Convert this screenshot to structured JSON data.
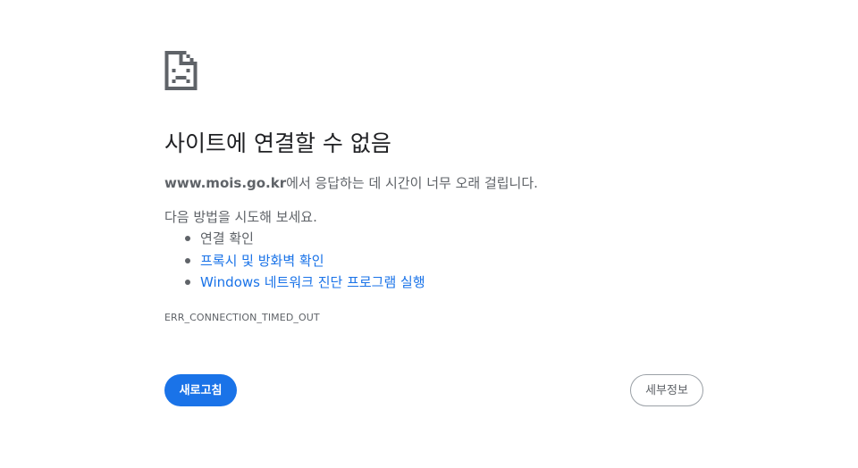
{
  "error_page": {
    "icon": "sad-document-icon",
    "headline": "사이트에 연결할 수 없음",
    "summary_host": "www.mois.go.kr",
    "summary_rest": "에서 응답하는 데 시간이 너무 오래 걸립니다.",
    "suggestions_intro": "다음 방법을 시도해 보세요.",
    "suggestions": [
      {
        "label": "연결 확인",
        "is_link": false
      },
      {
        "label": "프록시 및 방화벽 확인",
        "is_link": true
      },
      {
        "label": "Windows 네트워크 진단 프로그램 실행",
        "is_link": true
      }
    ],
    "error_code": "ERR_CONNECTION_TIMED_OUT",
    "reload_button": "새로고침",
    "details_button": "세부정보"
  },
  "colors": {
    "primary_blue": "#1a73e8",
    "text_dark": "#202124",
    "text_secondary": "#5f6368",
    "button_border": "#9aa0a6",
    "background": "#ffffff"
  }
}
